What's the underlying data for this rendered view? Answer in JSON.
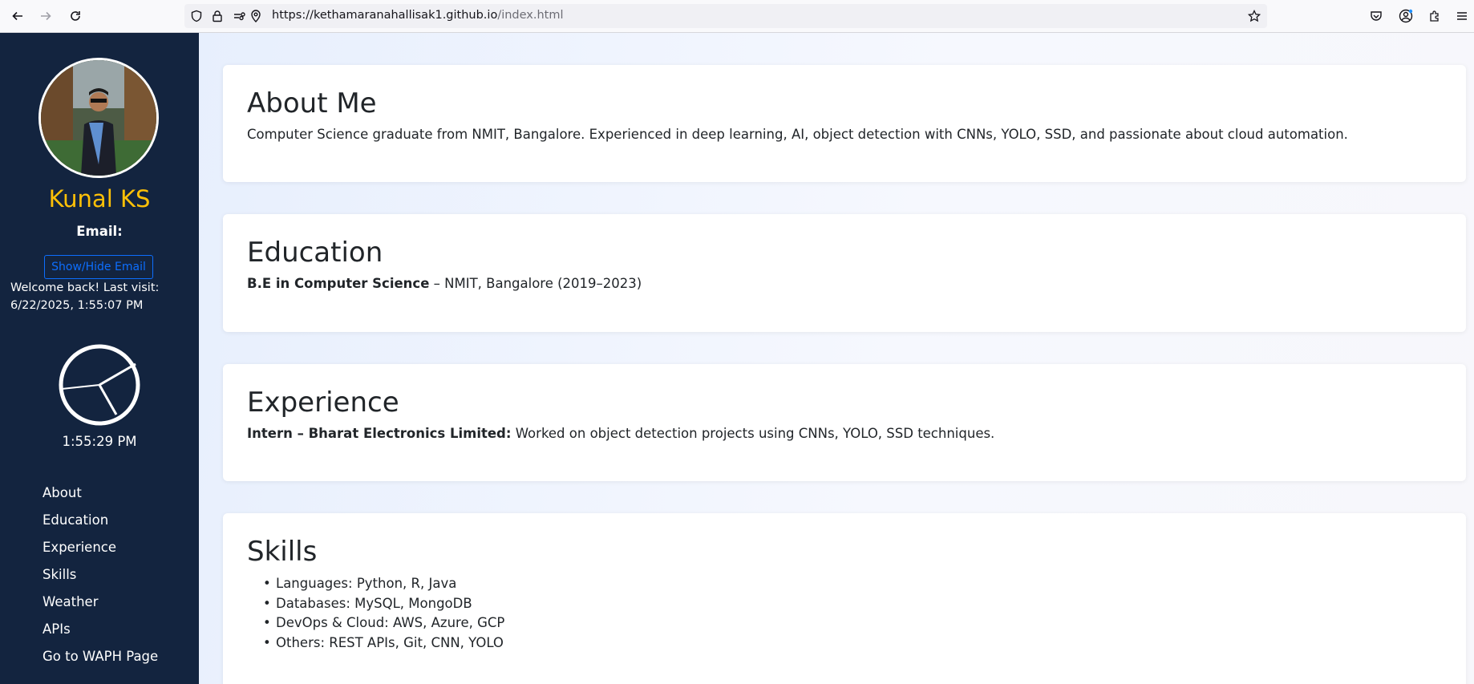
{
  "browser": {
    "url_host": "https://kethamaranahallisak1.github.io",
    "url_path": "/index.html"
  },
  "sidebar": {
    "name": "Kunal KS",
    "email_label": "Email:",
    "email_button": "Show/Hide Email",
    "welcome": "Welcome back! Last visit: 6/22/2025, 1:55:07 PM",
    "clock_time": "1:55:29 PM",
    "nav": [
      {
        "label": "About"
      },
      {
        "label": "Education"
      },
      {
        "label": "Experience"
      },
      {
        "label": "Skills"
      },
      {
        "label": "Weather"
      },
      {
        "label": "APIs"
      },
      {
        "label": "Go to WAPH Page"
      }
    ]
  },
  "about": {
    "title": "About Me",
    "text": "Computer Science graduate from NMIT, Bangalore. Experienced in deep learning, AI, object detection with CNNs, YOLO, SSD, and passionate about cloud automation."
  },
  "education": {
    "title": "Education",
    "degree": "B.E in Computer Science",
    "detail": " – NMIT, Bangalore (2019–2023)"
  },
  "experience": {
    "title": "Experience",
    "role": "Intern – Bharat Electronics Limited:",
    "detail": " Worked on object detection projects using CNNs, YOLO, SSD techniques."
  },
  "skills": {
    "title": "Skills",
    "items": [
      "Languages: Python, R, Java",
      "Databases: MySQL, MongoDB",
      "DevOps & Cloud: AWS, Azure, GCP",
      "Others: REST APIs, Git, CNN, YOLO"
    ]
  },
  "colors": {
    "sidebar_bg": "#13243f",
    "name_accent": "#ffc107",
    "button_accent": "#0d6efd"
  }
}
